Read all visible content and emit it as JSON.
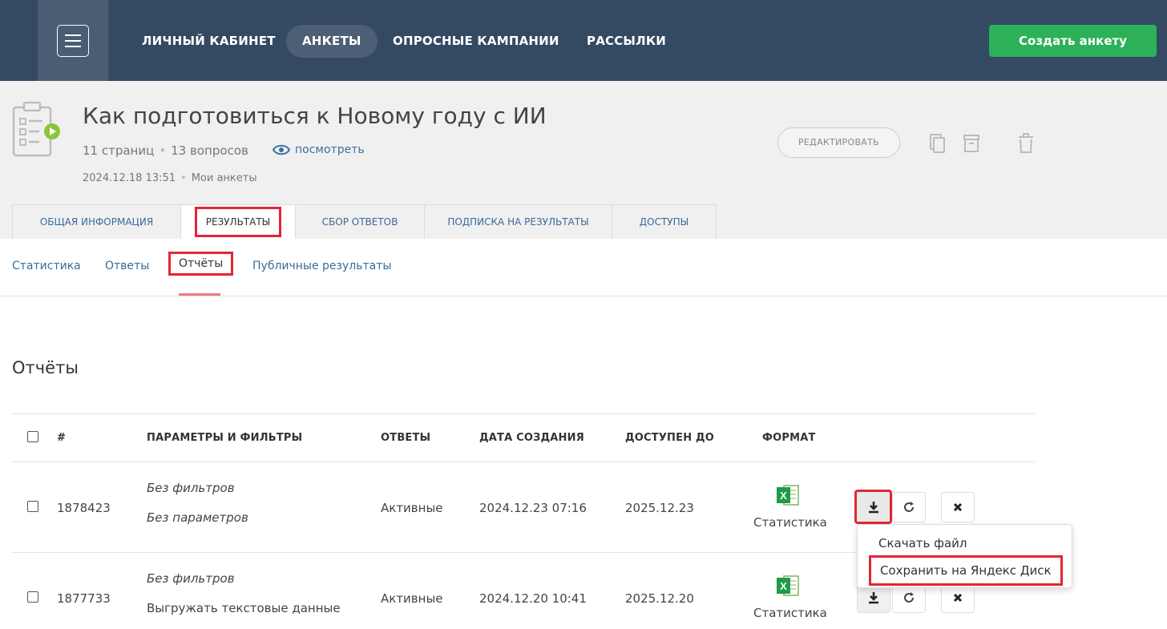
{
  "nav": {
    "items": [
      "ЛИЧНЫЙ КАБИНЕТ",
      "АНКЕТЫ",
      "ОПРОСНЫЕ КАМПАНИИ",
      "РАССЫЛКИ"
    ],
    "create_label": "Создать анкету"
  },
  "survey": {
    "title": "Как подготовиться к Новому году с ИИ",
    "pages": "11 страниц",
    "questions": "13 вопросов",
    "view_label": "посмотреть",
    "date": "2024.12.18 13:51",
    "folder": "Мои анкеты",
    "edit_label": "РЕДАКТИРОВАТЬ"
  },
  "tabs": [
    "ОБЩАЯ ИНФОРМАЦИЯ",
    "РЕЗУЛЬТАТЫ",
    "СБОР ОТВЕТОВ",
    "ПОДПИСКА НА РЕЗУЛЬТАТЫ",
    "ДОСТУПЫ"
  ],
  "subtabs": [
    "Статистика",
    "Ответы",
    "Отчёты",
    "Публичные результаты"
  ],
  "section_title": "Отчёты",
  "table": {
    "headers": [
      "#",
      "ПАРАМЕТРЫ И ФИЛЬТРЫ",
      "ОТВЕТЫ",
      "ДАТА СОЗДАНИЯ",
      "ДОСТУПЕН ДО",
      "ФОРМАТ"
    ],
    "rows": [
      {
        "id": "1878423",
        "filters": "Без фильтров",
        "params": "Без параметров",
        "answers": "Активные",
        "created": "2024.12.23 07:16",
        "until": "2025.12.23",
        "format": "Статистика"
      },
      {
        "id": "1877733",
        "filters": "Без фильтров",
        "params": "Выгружать текстовые данные",
        "answers": "Активные",
        "created": "2024.12.20 10:41",
        "until": "2025.12.20",
        "format": "Статистика"
      }
    ]
  },
  "dropdown": {
    "download": "Скачать файл",
    "save_yandex": "Сохранить на Яндекс Диск"
  },
  "colors": {
    "nav_bg": "#344a63",
    "accent_green": "#2db158",
    "highlight_red": "#e32636",
    "link_blue": "#3a6a99"
  }
}
